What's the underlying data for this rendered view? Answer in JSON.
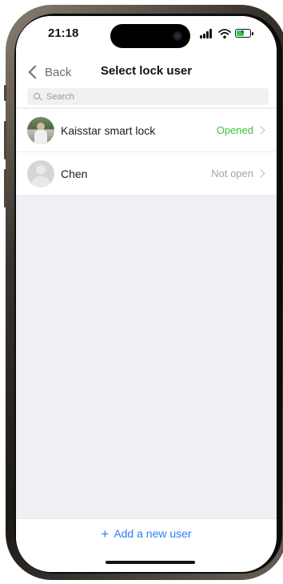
{
  "status_bar": {
    "time": "21:18",
    "icons": [
      "signal-icon",
      "wifi-icon",
      "battery-charging-icon"
    ]
  },
  "nav": {
    "back_label": "Back",
    "title": "Select lock user"
  },
  "search": {
    "placeholder": "Search",
    "value": ""
  },
  "users": [
    {
      "name": "Kaisstar smart lock",
      "status": "Opened",
      "avatar": "photo",
      "status_color": "#3cc13b"
    },
    {
      "name": "Chen",
      "status": "Not open",
      "avatar": "default",
      "status_color": "#a4a4a8"
    }
  ],
  "footer": {
    "add_user_label": "Add a new user",
    "accent": "#2f7cf6"
  }
}
